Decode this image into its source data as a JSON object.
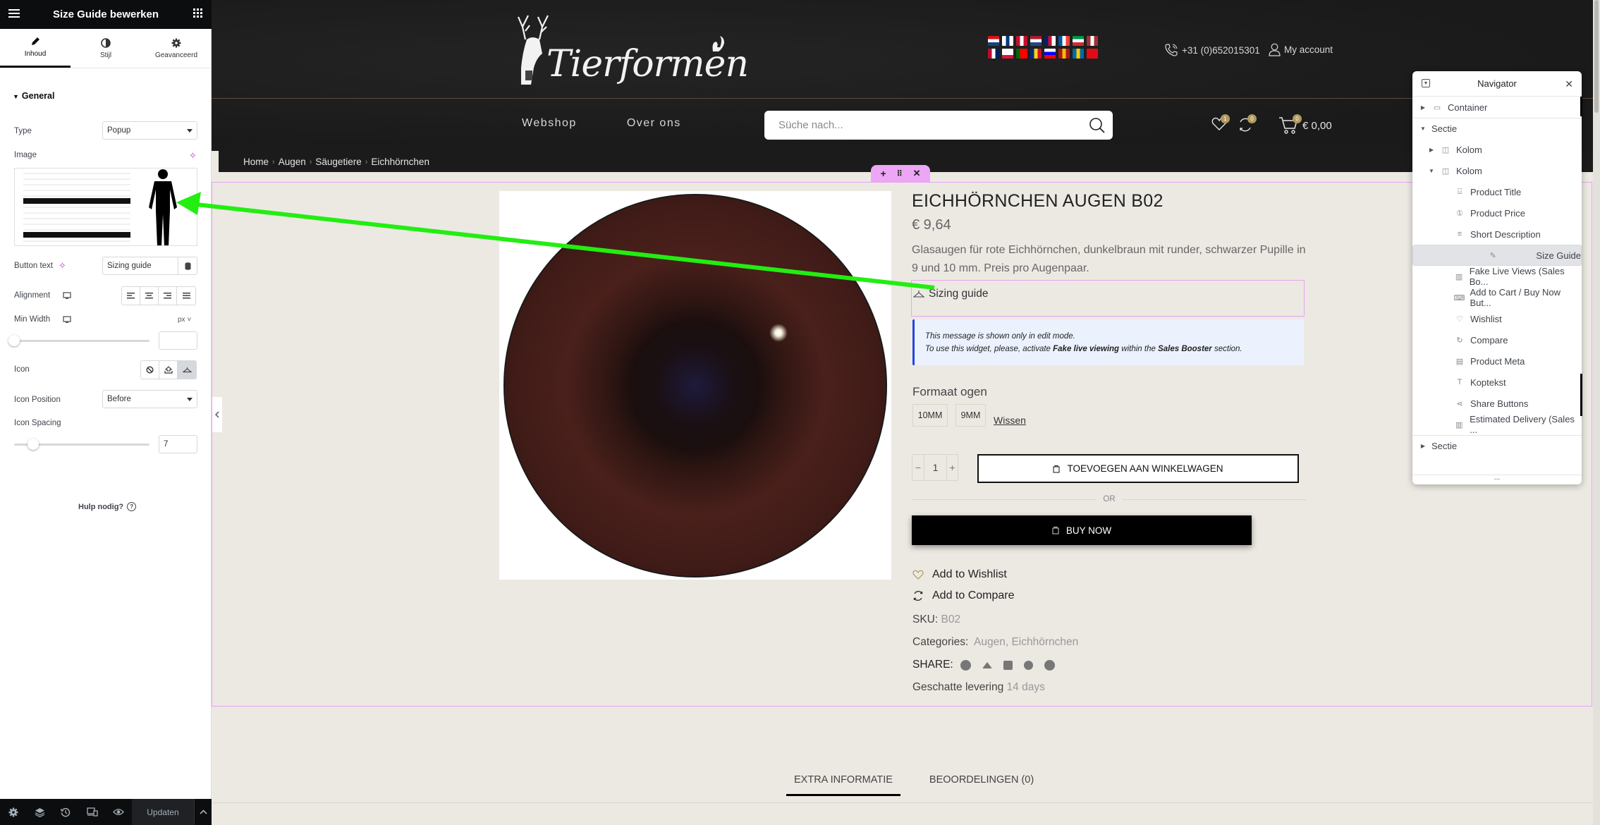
{
  "editor": {
    "title": "Size Guide bewerken",
    "tabs": [
      {
        "label": "Inhoud",
        "icon": "pencil-icon",
        "active": true
      },
      {
        "label": "Stijl",
        "icon": "half-circle-icon",
        "active": false
      },
      {
        "label": "Geavanceerd",
        "icon": "gear-icon",
        "active": false
      }
    ],
    "section_title": "General",
    "fields": {
      "type_label": "Type",
      "type_value": "Popup",
      "image_label": "Image",
      "button_text_label": "Button text",
      "button_text_value": "Sizing guide",
      "alignment_label": "Alignment",
      "min_width_label": "Min Width",
      "min_width_unit": "px",
      "min_width_value": "",
      "icon_label": "Icon",
      "icon_position_label": "Icon Position",
      "icon_position_value": "Before",
      "icon_spacing_label": "Icon Spacing",
      "icon_spacing_value": "7"
    },
    "help_label": "Hulp nodig?",
    "footer": {
      "update_label": "Updaten"
    }
  },
  "site": {
    "brand": "Tierformen",
    "phone": "+31 (0)652015301",
    "account_label": "My account",
    "nav": [
      "Webshop",
      "Over ons"
    ],
    "search_placeholder": "Süche nach...",
    "wishlist_count": "1",
    "compare_count": "0",
    "cart_count": "0",
    "cart_total": "€ 0,00",
    "flags": [
      [
        "#d7141a",
        "#ffffff",
        "#11457e"
      ],
      [
        "#ffffff",
        "#003580",
        "#ffffff"
      ],
      [
        "#c60c30",
        "#ffffff",
        "#c60c30"
      ],
      [
        "#ae1c28",
        "#ffffff",
        "#21468b"
      ],
      [
        "#012169",
        "#c8102e",
        "#ffffff"
      ],
      [
        "#0055a4",
        "#ffffff",
        "#ef4135"
      ],
      [
        "#009246",
        "#ffffff",
        "#ce2b37"
      ],
      [
        "#9e3039",
        "#ffffff",
        "#9e3039"
      ],
      [
        "#ba0c2f",
        "#ffffff",
        "#00205b"
      ],
      [
        "#ffffff",
        "#ffffff",
        "#dc143c"
      ],
      [
        "#006600",
        "#ff0000",
        "#ff0000"
      ],
      [
        "#002b7f",
        "#fcd116",
        "#ce1126"
      ],
      [
        "#ffffff",
        "#0000ff",
        "#ff0000"
      ],
      [
        "#aa151b",
        "#f1bf00",
        "#aa151b"
      ],
      [
        "#006aa7",
        "#fecc00",
        "#006aa7"
      ],
      [
        "#e30a17",
        "#e30a17",
        "#e30a17"
      ]
    ]
  },
  "breadcrumb": [
    "Home",
    "Augen",
    "Säugetiere",
    "Eichhörnchen"
  ],
  "product": {
    "title": "EICHHÖRNCHEN AUGEN B02",
    "price": "€ 9,64",
    "description": "Glasaugen für rote Eichhörnchen, dunkelbraun mit runder, schwarzer Pupille in 9 und 10 mm. Preis pro Augenpaar.",
    "size_guide_label": "Sizing guide",
    "notice_line1": "This message is shown only in edit mode.",
    "notice_pre": "To use this widget, please, activate ",
    "notice_bold1": "Fake live viewing",
    "notice_mid": " within the ",
    "notice_bold2": "Sales Booster",
    "notice_post": " section.",
    "attribute_label": "Formaat ogen",
    "attribute_options": [
      "10MM",
      "9MM"
    ],
    "clear_label": "Wissen",
    "quantity": "1",
    "add_to_cart_label": "TOEVOEGEN AAN WINKELWAGEN",
    "or_label": "OR",
    "buy_now_label": "BUY NOW",
    "wishlist_label": "Add to Wishlist",
    "compare_label": "Add to Compare",
    "sku_label": "SKU:",
    "sku_value": "B02",
    "categories_label": "Categories:",
    "categories_value": "Augen, Eichhörnchen",
    "share_label": "SHARE:",
    "share_icons": [
      "facebook-icon",
      "twitter-icon",
      "linkedin-icon",
      "skype-icon",
      "telegram-icon"
    ],
    "delivery_label": "Geschatte levering",
    "delivery_value": "14 days",
    "tabs": [
      {
        "label": "EXTRA INFORMATIE",
        "active": true
      },
      {
        "label": "BEOORDELINGEN (0)",
        "active": false
      }
    ]
  },
  "navigator": {
    "title": "Navigator",
    "items": [
      {
        "label": "Container",
        "level": 0,
        "arrow": "right",
        "icon": "container-icon"
      },
      {
        "label": "Sectie",
        "level": 0,
        "arrow": "down",
        "icon": ""
      },
      {
        "label": "Kolom",
        "level": 1,
        "arrow": "right",
        "icon": "column-icon"
      },
      {
        "label": "Kolom",
        "level": 1,
        "arrow": "down",
        "icon": "column-icon"
      },
      {
        "label": "Product Title",
        "level": 2,
        "arrow": "",
        "icon": "product-title-icon"
      },
      {
        "label": "Product Price",
        "level": 2,
        "arrow": "",
        "icon": "product-price-icon"
      },
      {
        "label": "Short Description",
        "level": 2,
        "arrow": "",
        "icon": "short-description-icon"
      },
      {
        "label": "Size Guide",
        "level": 2,
        "arrow": "",
        "icon": "ruler-icon",
        "selected": true
      },
      {
        "label": "Fake Live Views (Sales Bo...",
        "level": 2,
        "arrow": "",
        "icon": "chart-icon"
      },
      {
        "label": "Add to Cart / Buy Now But...",
        "level": 2,
        "arrow": "",
        "icon": "cart-button-icon"
      },
      {
        "label": "Wishlist",
        "level": 2,
        "arrow": "",
        "icon": "heart-icon"
      },
      {
        "label": "Compare",
        "level": 2,
        "arrow": "",
        "icon": "refresh-icon"
      },
      {
        "label": "Product Meta",
        "level": 2,
        "arrow": "",
        "icon": "meta-icon"
      },
      {
        "label": "Koptekst",
        "level": 2,
        "arrow": "",
        "icon": "heading-icon"
      },
      {
        "label": "Share Buttons",
        "level": 2,
        "arrow": "",
        "icon": "share-icon"
      },
      {
        "label": "Estimated Delivery (Sales ...",
        "level": 2,
        "arrow": "",
        "icon": "chart-icon"
      },
      {
        "label": "Sectie",
        "level": 0,
        "arrow": "right",
        "icon": ""
      }
    ],
    "more_label": "..."
  },
  "annotation_color": "#22ee11"
}
